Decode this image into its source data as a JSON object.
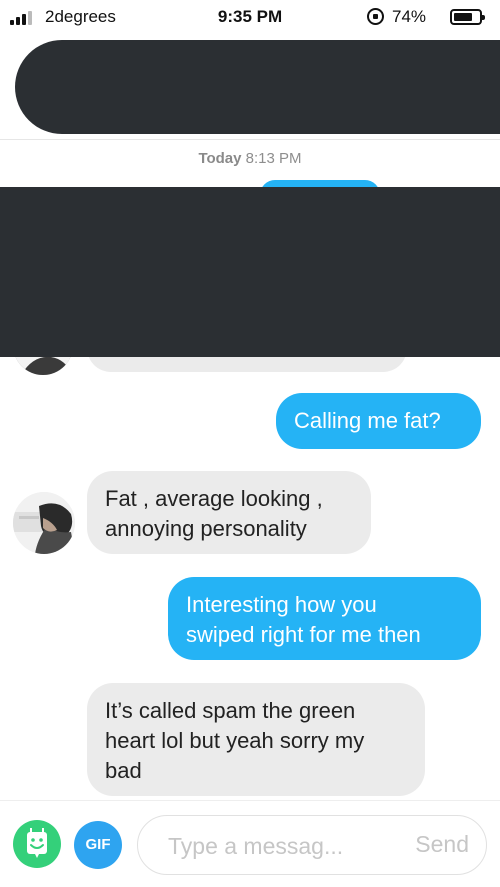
{
  "status_bar": {
    "carrier": "2degrees",
    "time": "9:35 PM",
    "battery_percent": "74%",
    "battery_level": 0.74
  },
  "conversation": {
    "date_day": "Today",
    "date_time": "8:13 PM",
    "messages": [
      {
        "direction": "out",
        "lines": [
          "Calling me fat?"
        ]
      },
      {
        "direction": "in",
        "lines": [
          "Fat , average looking ,",
          "annoying personality"
        ]
      },
      {
        "direction": "out",
        "lines": [
          "Interesting how you",
          "swiped right for me then"
        ]
      },
      {
        "direction": "in",
        "lines": [
          "It’s called spam the green",
          "heart lol but yeah sorry my",
          "bad"
        ]
      }
    ]
  },
  "composer": {
    "gif_label": "GIF",
    "placeholder": "Type a messag...",
    "send_label": "Send"
  },
  "colors": {
    "outgoing_bubble": "#25b3f5",
    "incoming_bubble": "#ebebeb",
    "sticker_button": "#34d07a",
    "gif_button": "#2ea4f0",
    "redaction": "#2b2f33"
  }
}
